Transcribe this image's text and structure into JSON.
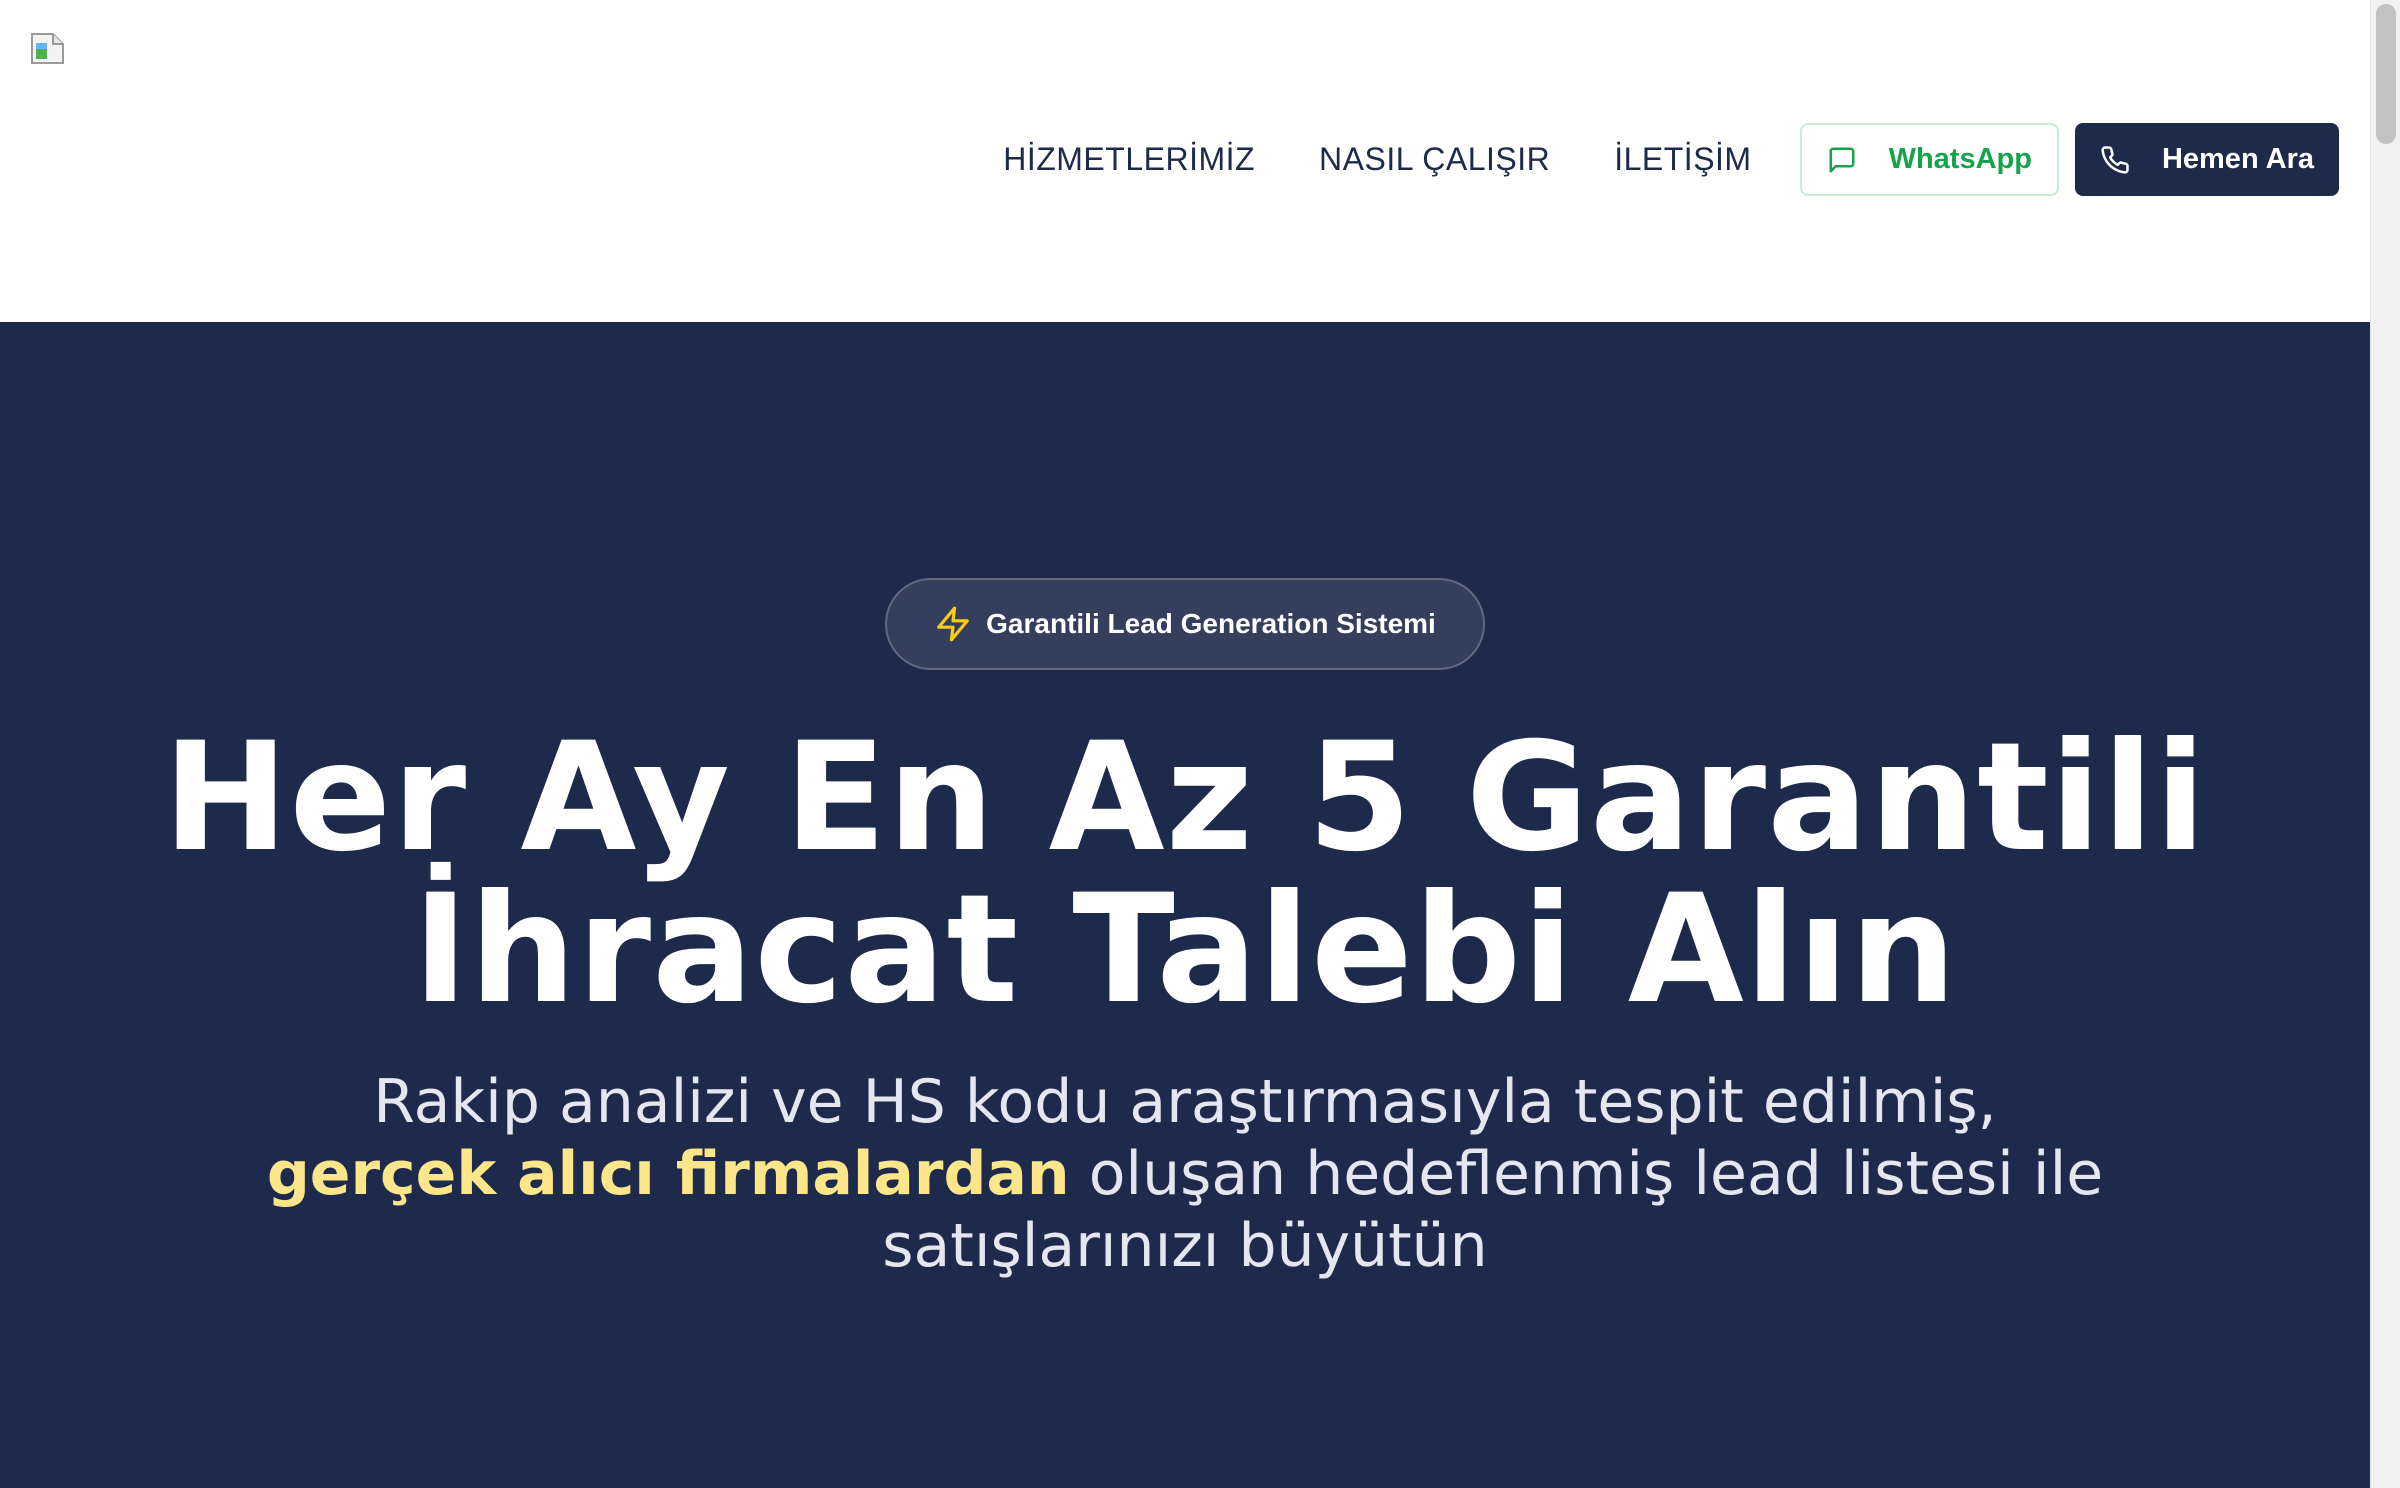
{
  "header": {
    "nav": {
      "services": "HİZMETLERİMİZ",
      "how_it_works": "NASIL ÇALIŞIR",
      "contact": "İLETİŞİM"
    },
    "whatsapp_label": "WhatsApp",
    "call_label": "Hemen Ara"
  },
  "hero": {
    "badge": "Garantili Lead Generation Sistemi",
    "headline_line1": "Her Ay En Az 5 Garantili",
    "headline_line2": "İhracat Talebi Alın",
    "subtitle_line1": "Rakip analizi ve HS kodu araştırmasıyla tespit edilmiş,",
    "subtitle_highlight": "gerçek alıcı firmalardan",
    "subtitle_line2_rest": " oluşan hedeflenmiş lead listesi ile",
    "subtitle_line3": "satışlarınızı büyütün"
  },
  "colors": {
    "navy": "#1e2a4c",
    "whatsapp_green": "#16a34a",
    "highlight_yellow": "#fde68a",
    "badge_bolt": "#facc15"
  },
  "icons": {
    "logo": "broken-image-icon",
    "whatsapp": "chat-bubble-icon",
    "call": "phone-icon",
    "badge": "lightning-bolt-icon"
  }
}
